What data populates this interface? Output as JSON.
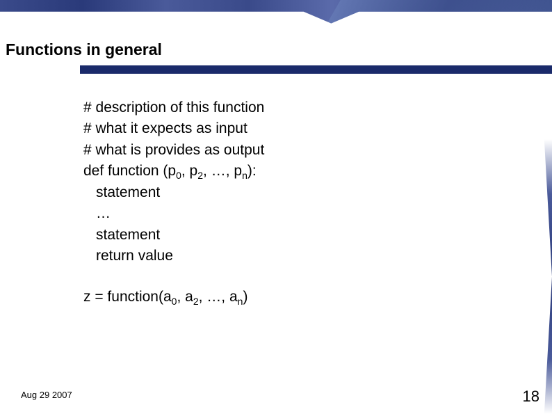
{
  "title": "Functions in general",
  "lines": {
    "l1": "# description of this function",
    "l2": "# what it expects as input",
    "l3": "# what is provides as output",
    "def_pre": "def function (p",
    "def_s0": "0",
    "def_mid1": ", p",
    "def_s2": "2",
    "def_mid2": ", …, p",
    "def_sn": "n",
    "def_post": "):",
    "stmt": "statement",
    "dots": "…",
    "ret": "return value",
    "call_pre": "z = function(a",
    "call_s0": "0",
    "call_mid1": ", a",
    "call_s2": "2",
    "call_mid2": ", …, a",
    "call_sn": "n",
    "call_post": ")"
  },
  "footer": {
    "date": "Aug 29 2007",
    "page": "18"
  }
}
